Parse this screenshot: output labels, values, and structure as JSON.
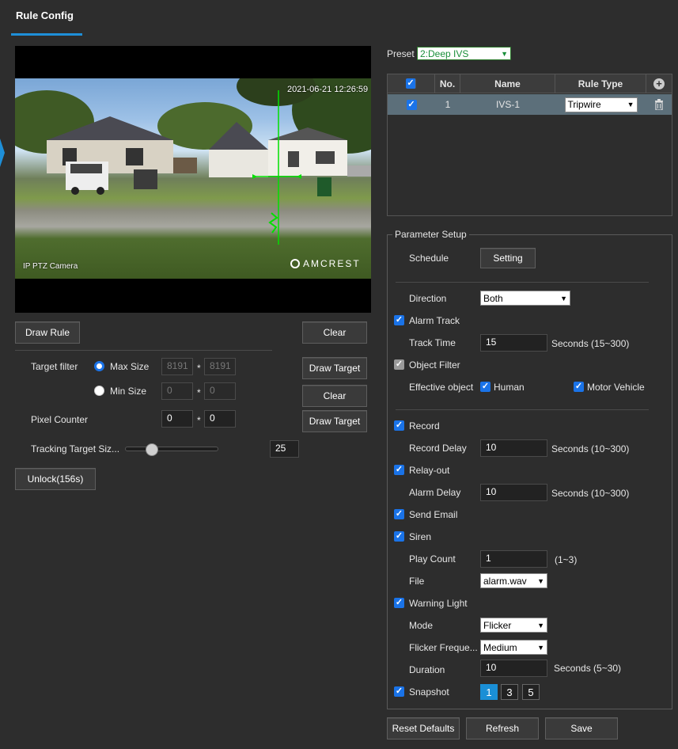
{
  "page": {
    "tab_title": "Rule Config"
  },
  "video": {
    "timestamp": "2021-06-21 12:26:59",
    "camera_label": "IP PTZ Camera",
    "watermark": "AMCREST"
  },
  "left": {
    "draw_rule": "Draw Rule",
    "clear": "Clear",
    "target_filter_label": "Target filter",
    "max_size_label": "Max Size",
    "min_size_label": "Min Size",
    "max_w": "8191",
    "max_h": "8191",
    "min_w": "0",
    "min_h": "0",
    "times": "*",
    "draw_target": "Draw Target",
    "clear2": "Clear",
    "draw_target2": "Draw Target",
    "pixel_counter_label": "Pixel Counter",
    "pixel_w": "0",
    "pixel_h": "0",
    "tracking_label": "Tracking Target Siz...",
    "tracking_value": "25",
    "tracking_level": 0.25,
    "unlock": "Unlock(156s)"
  },
  "preset": {
    "label": "Preset",
    "value": "2:Deep IVS"
  },
  "rules_table": {
    "headers": {
      "no": "No.",
      "name": "Name",
      "type": "Rule Type"
    },
    "rows": [
      {
        "no": "1",
        "name": "IVS-1",
        "type": "Tripwire"
      }
    ]
  },
  "params": {
    "legend": "Parameter Setup",
    "schedule_label": "Schedule",
    "schedule_btn": "Setting",
    "direction_label": "Direction",
    "direction_value": "Both",
    "alarm_track": "Alarm Track",
    "track_time_label": "Track Time",
    "track_time": "15",
    "track_time_hint": "Seconds (15~300)",
    "object_filter": "Object Filter",
    "effective_label": "Effective object",
    "human": "Human",
    "motor": "Motor Vehicle",
    "record": "Record",
    "record_delay_label": "Record Delay",
    "record_delay": "10",
    "record_delay_hint": "Seconds (10~300)",
    "relay_out": "Relay-out",
    "alarm_delay_label": "Alarm Delay",
    "alarm_delay": "10",
    "alarm_delay_hint": "Seconds (10~300)",
    "send_email": "Send Email",
    "siren": "Siren",
    "play_count_label": "Play Count",
    "play_count": "1",
    "play_count_hint": "(1~3)",
    "file_label": "File",
    "file_value": "alarm.wav",
    "warning_light": "Warning Light",
    "mode_label": "Mode",
    "mode_value": "Flicker",
    "flicker_label": "Flicker Freque...",
    "flicker_value": "Medium",
    "duration_label": "Duration",
    "duration": "10",
    "duration_hint": "Seconds (5~30)",
    "snapshot": "Snapshot",
    "snap_options": [
      "1",
      "3",
      "5"
    ]
  },
  "footer": {
    "reset": "Reset Defaults",
    "refresh": "Refresh",
    "save": "Save"
  },
  "colors": {
    "accent": "#1e8fd8",
    "row_selected": "#5c6f7a",
    "tripwire": "#00e000"
  }
}
